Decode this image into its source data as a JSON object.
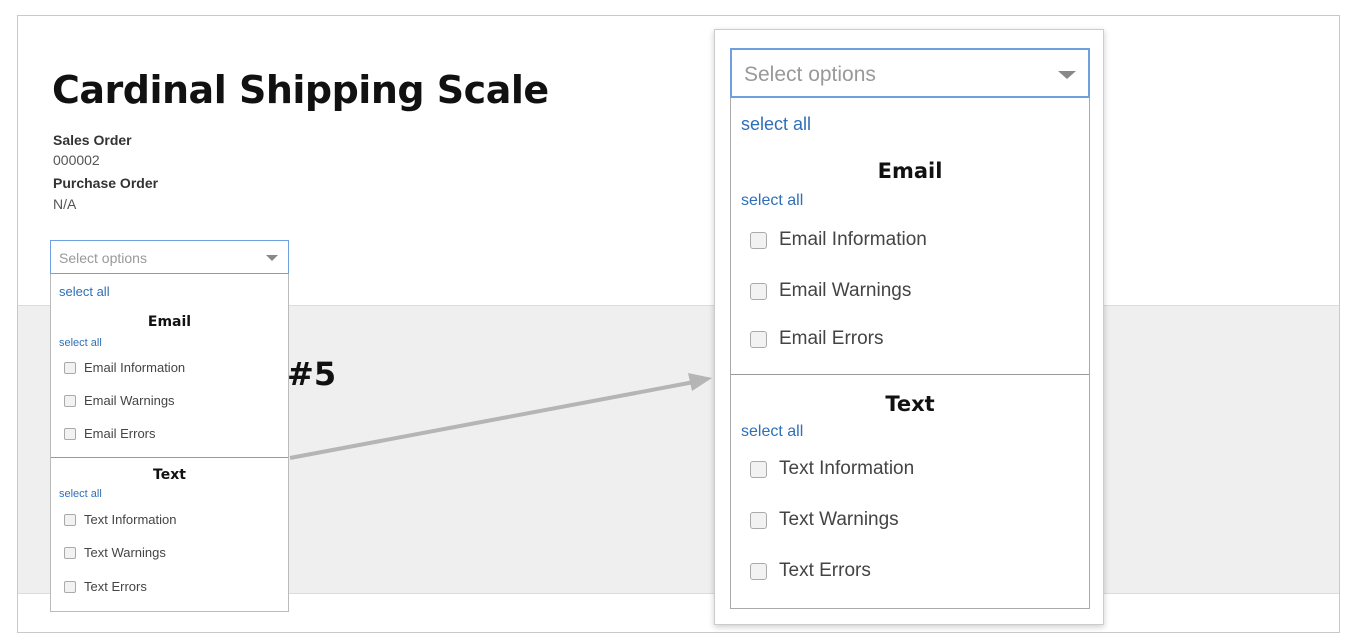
{
  "page": {
    "title": "Cardinal Shipping Scale",
    "sales_order_label": "Sales Order",
    "sales_order_value": "000002",
    "purchase_order_label": "Purchase Order",
    "purchase_order_value": "N/A",
    "partial_heading": "#5"
  },
  "multiselect": {
    "placeholder": "Select options",
    "select_all": "select all",
    "groups": [
      {
        "title": "Email",
        "select_all": "select all",
        "options": [
          "Email Information",
          "Email Warnings",
          "Email Errors"
        ]
      },
      {
        "title": "Text",
        "select_all": "select all",
        "options": [
          "Text Information",
          "Text Warnings",
          "Text Errors"
        ]
      }
    ]
  },
  "colors": {
    "link": "#2f6fb7",
    "focus_border": "#6f9fe0",
    "highlight": "#fde3e3",
    "band": "#efefef",
    "arrow": "#b5b5b5"
  },
  "icons": {
    "dropdown": "caret-down-icon",
    "checkbox": "checkbox-icon",
    "annotation": "arrow-icon"
  }
}
